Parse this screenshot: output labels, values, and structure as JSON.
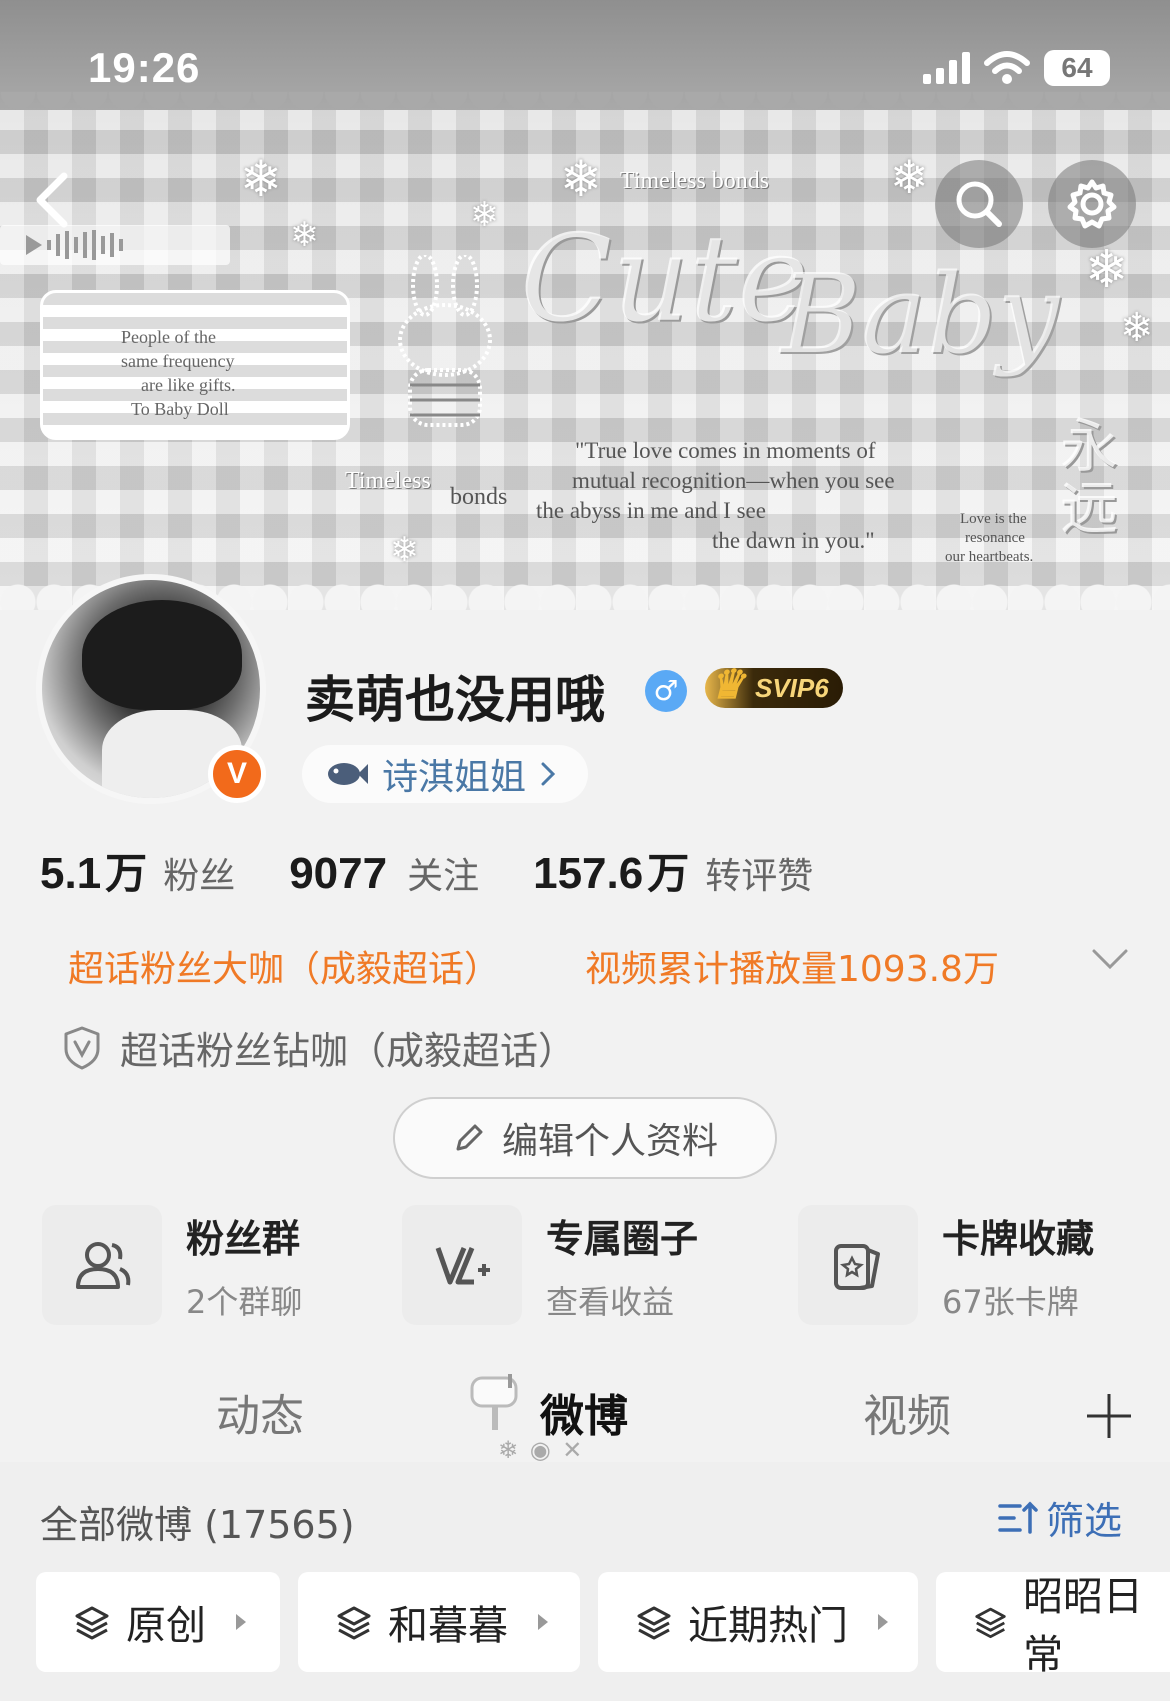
{
  "status_bar": {
    "time": "19:26",
    "battery": "64"
  },
  "banner": {
    "timeless_top": "Timeless bonds",
    "note_card_lines": [
      "People of the",
      "same frequency",
      "are like gifts.",
      "To Baby Doll"
    ],
    "deco_word_1": "Cute",
    "deco_word_2": "Baby",
    "timeless_left": "Timeless",
    "bonds_left": "bonds",
    "quote_lines": [
      "\"True love comes in moments of",
      "mutual recognition—when you see",
      "the abyss in me and I see",
      "the dawn in you.\""
    ],
    "side_lines": [
      "Love is the",
      "resonance",
      "our heartbeats."
    ],
    "vertical_chars": "永远"
  },
  "profile": {
    "name": "卖萌也没用哦",
    "gender_symbol": "♂",
    "vip_label": "SVIP6",
    "verified_mark": "V",
    "group_chip_label": "诗淇姐姐",
    "stats": [
      {
        "num": "5.1",
        "unit": "万",
        "label": "粉丝"
      },
      {
        "num": "9077",
        "unit": "",
        "label": "关注"
      },
      {
        "num": "157.6",
        "unit": "万",
        "label": "转评赞"
      }
    ],
    "honor_1": "超话粉丝大咖（成毅超话）",
    "honor_2": "视频累计播放量1093.8万",
    "diamond_label": "超话粉丝钻咖（成毅超话）",
    "edit_button": "编辑个人资料"
  },
  "features": [
    {
      "title": "粉丝群",
      "sub": "2个群聊",
      "icon": "group-icon"
    },
    {
      "title": "专属圈子",
      "sub": "查看收益",
      "icon": "v-plus-icon"
    },
    {
      "title": "卡牌收藏",
      "sub": "67张卡牌",
      "icon": "card-icon"
    }
  ],
  "tabs": [
    "动态",
    "微博",
    "视频"
  ],
  "feed": {
    "all_posts": "全部微博 (17565)",
    "filter": "筛选",
    "chips": [
      "原创",
      "和暮暮",
      "近期热门",
      "昭昭日常"
    ]
  },
  "colors": {
    "accent_orange": "#f07a26",
    "link_blue": "#3d6fb6",
    "verified_orange": "#f26a1b"
  }
}
